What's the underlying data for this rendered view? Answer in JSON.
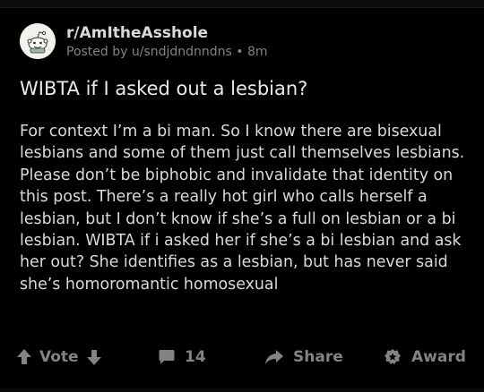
{
  "post": {
    "subreddit": "r/AmItheAsshole",
    "posted_by": "Posted by u/sndjdndnndns • 8m",
    "title": "WIBTA if I asked out a lesbian?",
    "body": "For context I’m a bi man. So I know there are bisexual lesbians and some of them just call themselves lesbians. Please don’t be biphobic and invalidate that identity on this post. There’s a really hot girl who calls herself a lesbian, but I don’t know if she’s a full on lesbian or a bi lesbian. WIBTA if i asked her if she’s a bi lesbian and ask her out? She identifies as a lesbian, but has never said she’s homoromantic homosexual"
  },
  "actions": {
    "vote_label": "Vote",
    "comments_count": "14",
    "share_label": "Share",
    "award_label": "Award"
  },
  "colors": {
    "background": "#000000",
    "text": "#d7dadc",
    "muted": "#818384"
  }
}
